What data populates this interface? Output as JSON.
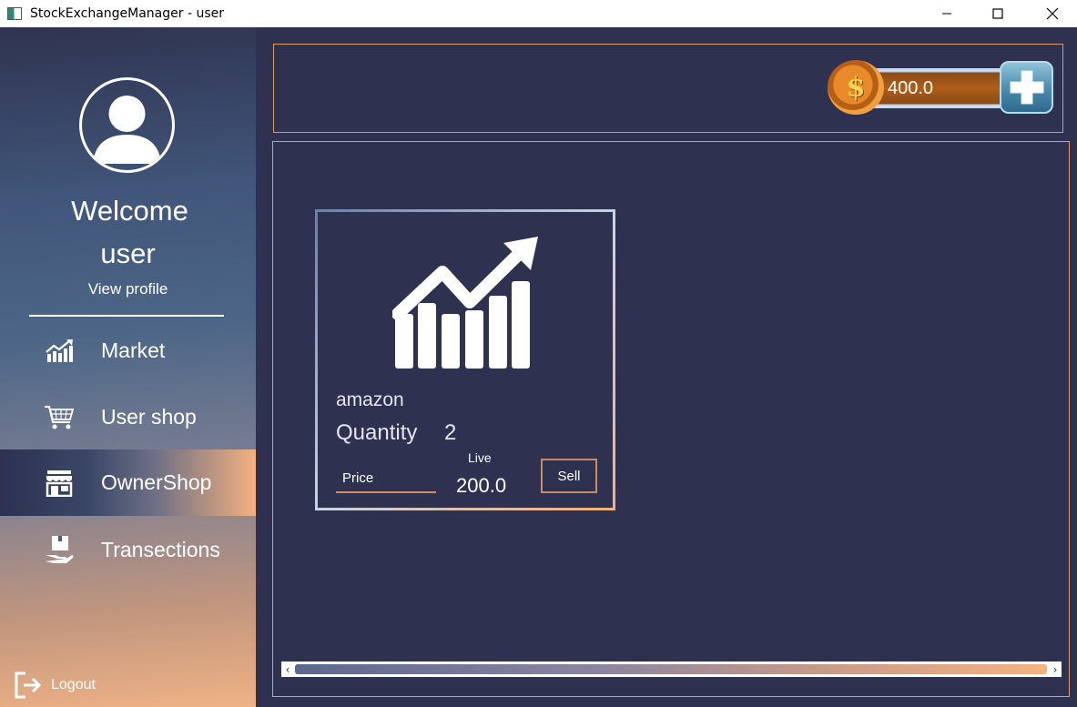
{
  "window": {
    "title": "StockExchangeManager - user"
  },
  "sidebar": {
    "welcome_line1": "Welcome",
    "welcome_line2": "user",
    "view_profile": "View profile",
    "items": [
      {
        "label": "Market",
        "icon": "chart-up-icon"
      },
      {
        "label": "User shop",
        "icon": "cart-icon"
      },
      {
        "label": "OwnerShop",
        "icon": "store-icon",
        "selected": true
      },
      {
        "label": "Transections",
        "icon": "hand-box-icon"
      }
    ],
    "logout_label": "Logout"
  },
  "header": {
    "balance": "400.0",
    "coin_symbol": "$"
  },
  "cards": [
    {
      "name": "amazon",
      "quantity_label": "Quantity",
      "quantity": "2",
      "price_placeholder": "Price",
      "live_label": "Live",
      "live_value": "200.0",
      "sell_label": "Sell"
    }
  ],
  "colors": {
    "background": "#2e3150",
    "panel_border": "#e19a6a",
    "accent_orange": "#f5b282"
  }
}
